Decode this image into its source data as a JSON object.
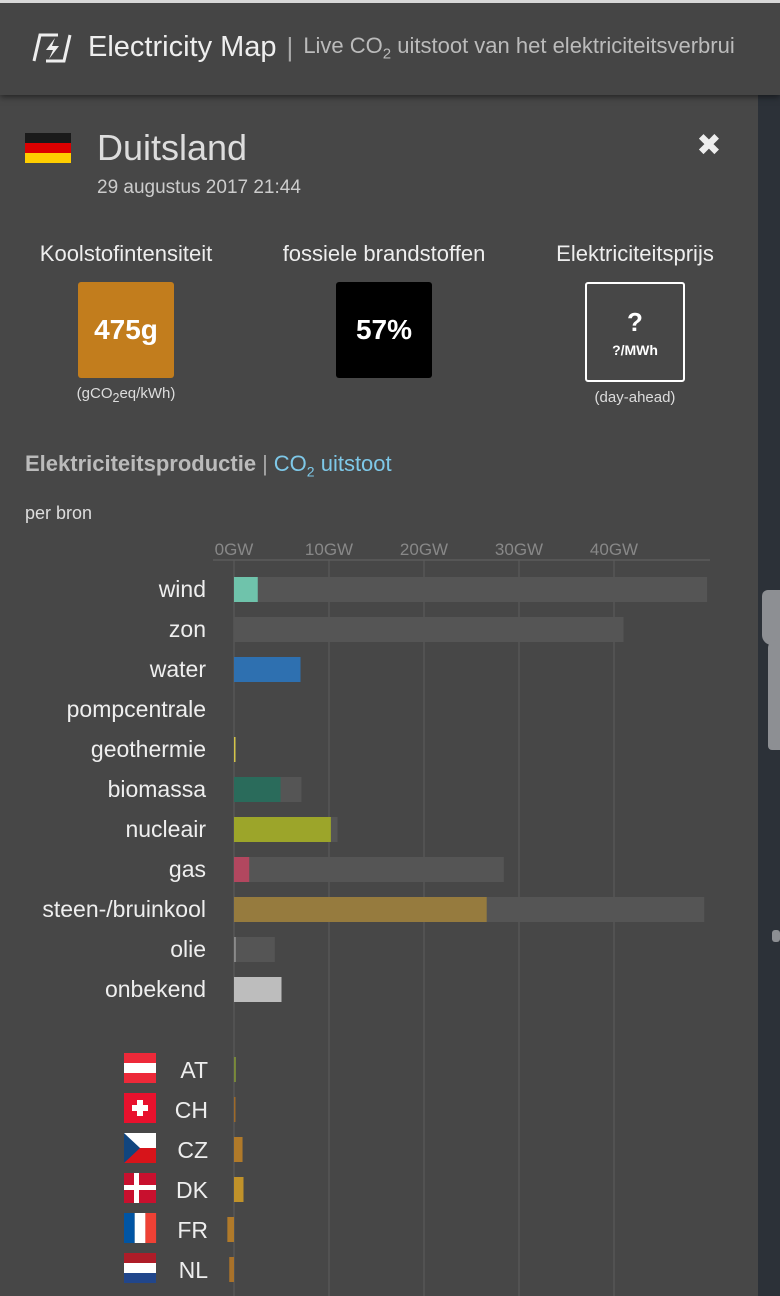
{
  "header": {
    "app_title": "Electricity Map",
    "separator": "|",
    "subtitle_part1": "Live CO",
    "subtitle_sub": "2",
    "subtitle_part2": " uitstoot van het elektriciteitsverbrui"
  },
  "country": {
    "name": "Duitsland",
    "datetime": "29 augustus 2017 21:44",
    "flag_colors": [
      "#1a1a1a",
      "#dd0000",
      "#ffce00"
    ]
  },
  "metrics": {
    "carbon": {
      "label": "Koolstofintensiteit",
      "value": "475g",
      "unit_part1": "(gCO",
      "unit_sub": "2",
      "unit_part2": "eq/kWh)",
      "color": "#c27d1d"
    },
    "fossil": {
      "label": "fossiele brandstoffen",
      "value": "57%",
      "color": "#000000"
    },
    "price": {
      "label": "Elektriciteitsprijs",
      "value": "?",
      "unit_inner": "?/MWh",
      "caption": "(day-ahead)"
    }
  },
  "section": {
    "tab_active": "Elektriciteitsproductie",
    "tab_sep": "|",
    "tab_other_part1": "CO",
    "tab_other_sub": "2",
    "tab_other_part2": " uitstoot",
    "per_source_label": "per bron"
  },
  "chart_data": {
    "type": "bar",
    "orientation": "horizontal",
    "unit": "GW",
    "xlim": [
      0,
      50
    ],
    "x_ticks": [
      "0GW",
      "10GW",
      "20GW",
      "30GW",
      "40GW"
    ],
    "x_tick_values": [
      0,
      10,
      20,
      30,
      40
    ],
    "grid": true,
    "categories": [
      "wind",
      "zon",
      "water",
      "pompcentrale",
      "geothermie",
      "biomassa",
      "nucleair",
      "gas",
      "steen-/bruinkool",
      "olie",
      "onbekend"
    ],
    "series": [
      {
        "role": "production",
        "values": [
          2.5,
          0,
          7.0,
          0,
          0.1,
          4.9,
          10.2,
          1.6,
          26.6,
          0.2,
          5.0
        ],
        "colors": [
          "#6fc3ab",
          "#f3e060",
          "#2e70b0",
          "#1f6f9f",
          "#d4c44a",
          "#2a6b5b",
          "#9ca52a",
          "#b2475f",
          "#967b3e",
          "#8a8a8a",
          "#bdbdbd"
        ]
      },
      {
        "role": "capacity",
        "values": [
          49.8,
          41.0,
          7.0,
          0,
          0.1,
          7.1,
          10.9,
          28.4,
          49.5,
          4.3,
          0
        ],
        "color": "#555555"
      }
    ],
    "exchanges": [
      {
        "code": "AT",
        "value": 0.2,
        "color": "#7a8a3a"
      },
      {
        "code": "CH",
        "value": 0.1,
        "color": "#9e6a2a"
      },
      {
        "code": "CZ",
        "value": 0.9,
        "color": "#b07a2a"
      },
      {
        "code": "DK",
        "value": 1.0,
        "color": "#c0922a"
      },
      {
        "code": "FR",
        "value": -0.7,
        "color": "#b07a2a"
      },
      {
        "code": "NL",
        "value": -0.5,
        "color": "#a9722a"
      }
    ]
  }
}
